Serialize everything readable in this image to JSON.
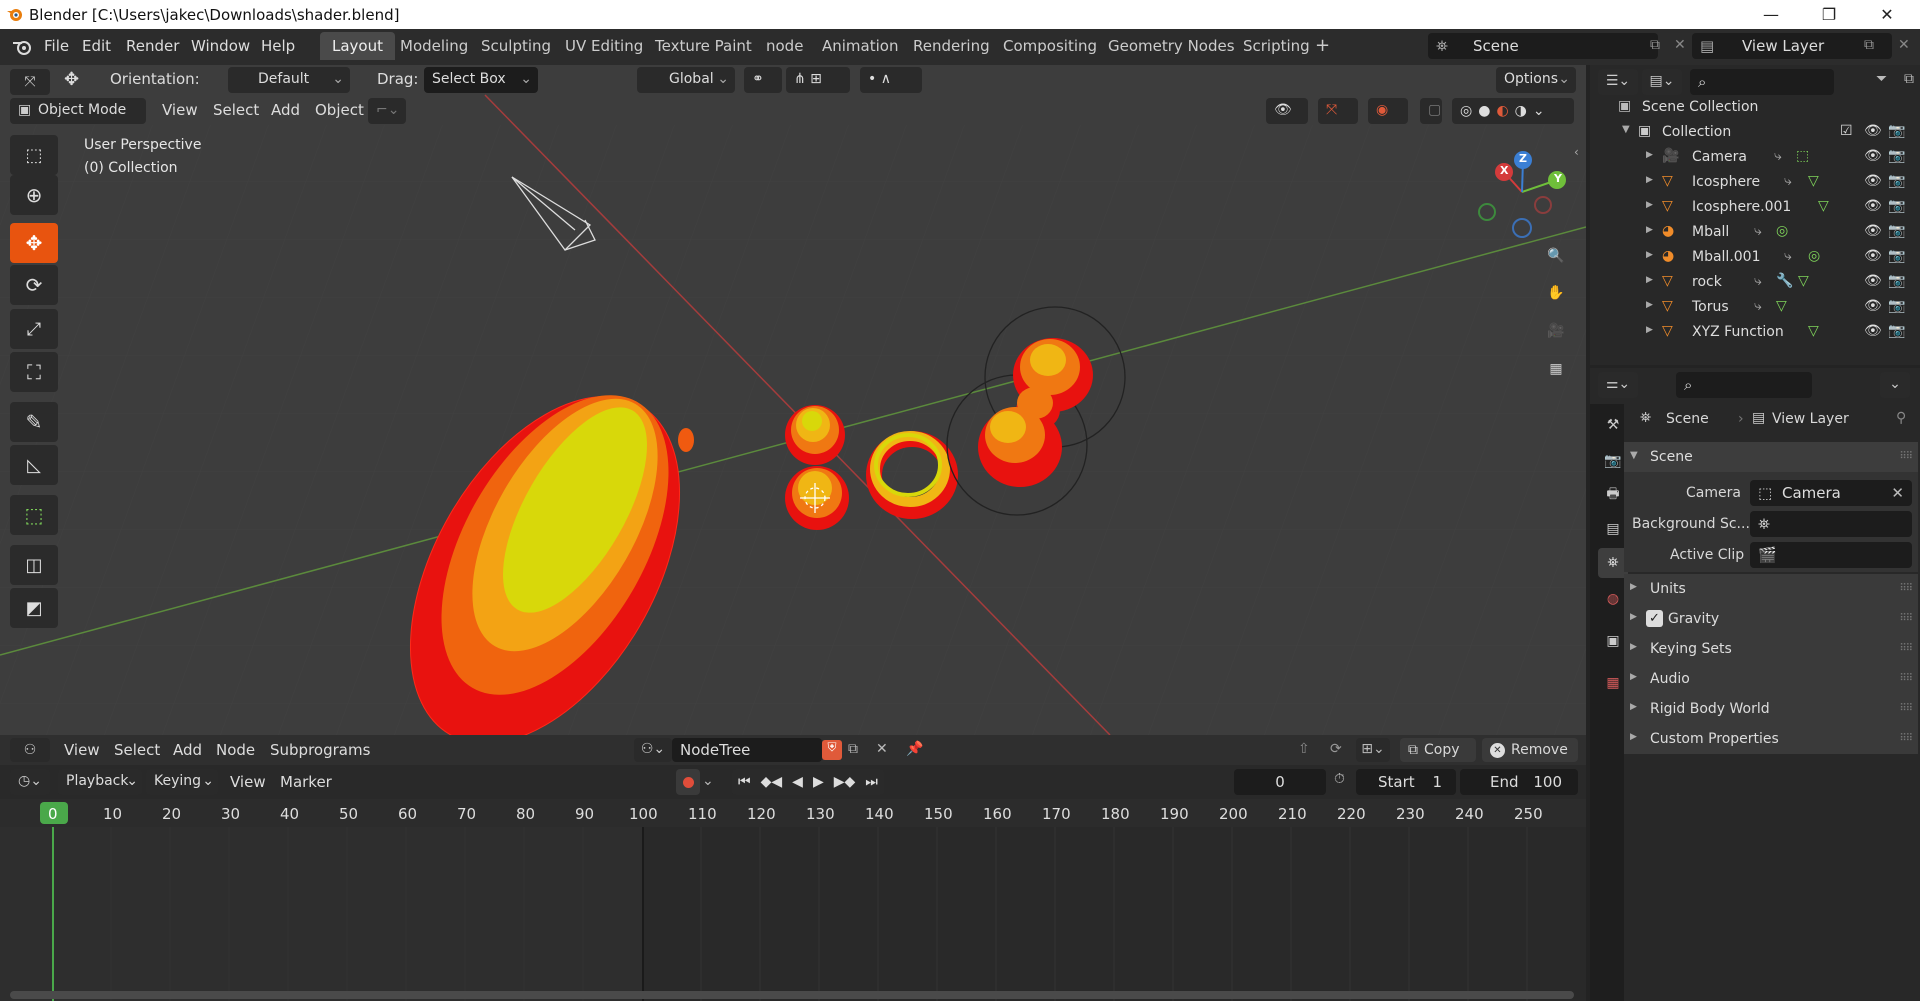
{
  "window": {
    "title": "Blender [C:\\Users\\jakec\\Downloads\\shader.blend]",
    "controls": [
      "minimize",
      "maximize",
      "close"
    ]
  },
  "menu": [
    "File",
    "Edit",
    "Render",
    "Window",
    "Help"
  ],
  "workspaces": [
    "Layout",
    "Modeling",
    "Sculpting",
    "UV Editing",
    "Texture Paint",
    "node",
    "Animation",
    "Rendering",
    "Compositing",
    "Geometry Nodes",
    "Scripting"
  ],
  "active_workspace": "Layout",
  "scene": {
    "name": "Scene",
    "view_layer": "View Layer"
  },
  "tool_header": {
    "orientation_label": "Orientation:",
    "orientation_value": "Default",
    "drag_label": "Drag:",
    "drag_value": "Select Box",
    "transform_orientation": "Global",
    "options": "Options"
  },
  "viewport_header": {
    "mode": "Object Mode",
    "menus": [
      "View",
      "Select",
      "Add",
      "Object"
    ]
  },
  "viewport": {
    "perspective": "User Perspective",
    "collection": "(0) Collection",
    "gizmo_axes": [
      "X",
      "Y",
      "Z"
    ]
  },
  "node_editor": {
    "menus": [
      "View",
      "Select",
      "Add",
      "Node",
      "Subprograms"
    ],
    "tree_name": "NodeTree",
    "copy": "Copy",
    "remove": "Remove"
  },
  "timeline": {
    "menus": [
      "Playback",
      "Keying",
      "View",
      "Marker"
    ],
    "current_frame": "0",
    "start_label": "Start",
    "start": "1",
    "end_label": "End",
    "end": "100",
    "ticks": [
      "0",
      "10",
      "20",
      "30",
      "40",
      "50",
      "60",
      "70",
      "80",
      "90",
      "100",
      "110",
      "120",
      "130",
      "140",
      "150",
      "160",
      "170",
      "180",
      "190",
      "200",
      "210",
      "220",
      "230",
      "240",
      "250"
    ]
  },
  "outliner": {
    "root": "Scene Collection",
    "collection": "Collection",
    "objects": [
      "Camera",
      "Icosphere",
      "Icosphere.001",
      "Mball",
      "Mball.001",
      "rock",
      "Torus",
      "XYZ Function"
    ]
  },
  "properties": {
    "breadcrumb_scene": "Scene",
    "breadcrumb_layer": "View Layer",
    "panel_title": "Scene",
    "camera_label": "Camera",
    "camera_value": "Camera",
    "background_label": "Background Sc...",
    "active_clip_label": "Active Clip",
    "sections": [
      "Units",
      "Gravity",
      "Keying Sets",
      "Audio",
      "Rigid Body World",
      "Custom Properties"
    ],
    "gravity_checked": true
  },
  "colors": {
    "accent": "#4d6fa1",
    "x_axis": "#d43b3b",
    "y_axis": "#6fbf3a",
    "z_axis": "#3b7fd4",
    "record": "#e04d3a"
  }
}
